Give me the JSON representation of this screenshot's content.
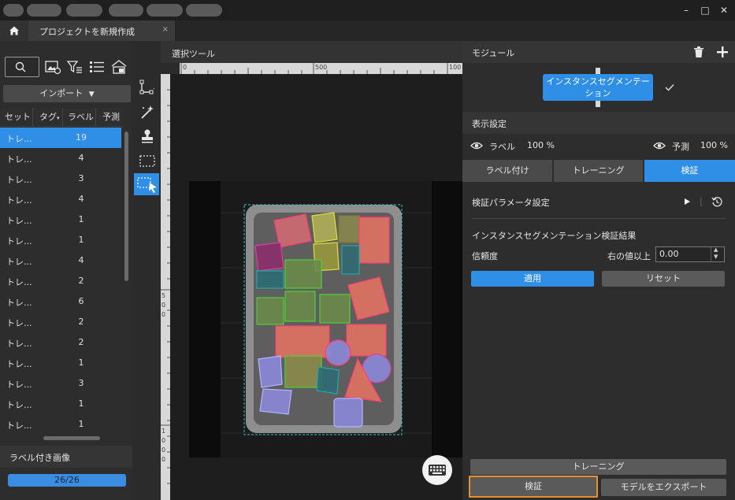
{
  "titlebar": {
    "window_controls": {
      "minimize": "–",
      "maximize": "□",
      "close": "✕"
    }
  },
  "tabbar": {
    "home_icon": "home-icon",
    "tab_title": "プロジェクトを新規作成",
    "tab_close": "×"
  },
  "left": {
    "import_label": "インポート",
    "columns": [
      "セット",
      "タグ",
      "ラベル",
      "予測"
    ],
    "rows": [
      {
        "set": "トレ...",
        "label": "19"
      },
      {
        "set": "トレ...",
        "label": "4"
      },
      {
        "set": "トレ...",
        "label": "3"
      },
      {
        "set": "トレ...",
        "label": "4"
      },
      {
        "set": "トレ...",
        "label": "1"
      },
      {
        "set": "トレ...",
        "label": "1"
      },
      {
        "set": "トレ...",
        "label": "4"
      },
      {
        "set": "トレ...",
        "label": "2"
      },
      {
        "set": "トレ...",
        "label": "6"
      },
      {
        "set": "トレ...",
        "label": "2"
      },
      {
        "set": "トレ...",
        "label": "2"
      },
      {
        "set": "トレ...",
        "label": "1"
      },
      {
        "set": "トレ...",
        "label": "3"
      },
      {
        "set": "トレ...",
        "label": "1"
      },
      {
        "set": "トレ...",
        "label": "1"
      }
    ],
    "labeled_images_title": "ラベル付き画像",
    "progress_text": "26/26",
    "progress_fraction": 1.0
  },
  "canvas": {
    "selection_tool_title": "選択ツール",
    "ruler_h_ticks": [
      "0",
      "500",
      "100"
    ],
    "ruler_v_ticks": [
      "5",
      "0",
      "0",
      "1",
      "0",
      "0",
      "0"
    ]
  },
  "right": {
    "module_title": "モジュール",
    "module_name": "インスタンスセグメンテーション",
    "display_settings_title": "表示設定",
    "label_vis_text": "ラベル",
    "label_vis_pct": "100 %",
    "pred_vis_text": "予測",
    "pred_vis_pct": "100 %",
    "tabs": [
      "ラベル付け",
      "トレーニング",
      "検証"
    ],
    "validation_param_settings": "検証パラメータ設定",
    "result_title": "インスタンスセグメンテーション検証結果",
    "confidence_label": "信頼度",
    "threshold_label": "右の値以上",
    "confidence_value": "0.00",
    "apply_label": "適用",
    "reset_label": "リセット",
    "train_label": "トレーニング",
    "validate_label": "検証",
    "export_label": "モデルをエクスポート"
  },
  "colors": {
    "accent": "#2f8fe6",
    "highlight_border": "#e8912a",
    "selected_row": "#2f8fe6"
  }
}
